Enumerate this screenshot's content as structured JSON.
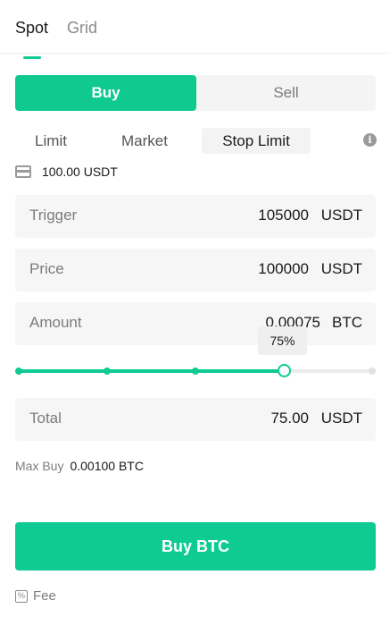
{
  "top_tabs": {
    "spot": "Spot",
    "grid": "Grid"
  },
  "side_toggle": {
    "buy": "Buy",
    "sell": "Sell"
  },
  "order_types": {
    "limit": "Limit",
    "market": "Market",
    "stop_limit": "Stop Limit",
    "active": "Stop Limit"
  },
  "balance": {
    "text": "100.00 USDT",
    "icon": "wallet-icon"
  },
  "trigger": {
    "label": "Trigger",
    "value": "105000",
    "unit": "USDT"
  },
  "price": {
    "label": "Price",
    "value": "100000",
    "unit": "USDT"
  },
  "amount": {
    "label": "Amount",
    "value": "0.00075",
    "unit": "BTC"
  },
  "slider": {
    "percent": 75,
    "tooltip": "75%",
    "marks": [
      0,
      25,
      50,
      75,
      100
    ]
  },
  "total": {
    "label": "Total",
    "value": "75.00",
    "unit": "USDT"
  },
  "max_buy": {
    "label": "Max Buy",
    "value": "0.00100 BTC"
  },
  "buy_button": {
    "label": "Buy BTC"
  },
  "fee": {
    "label": "Fee",
    "icon": "percent-icon"
  },
  "colors": {
    "accent": "#0ecb93",
    "field_bg": "#f6f6f6",
    "muted_text": "#7c7c7c"
  }
}
